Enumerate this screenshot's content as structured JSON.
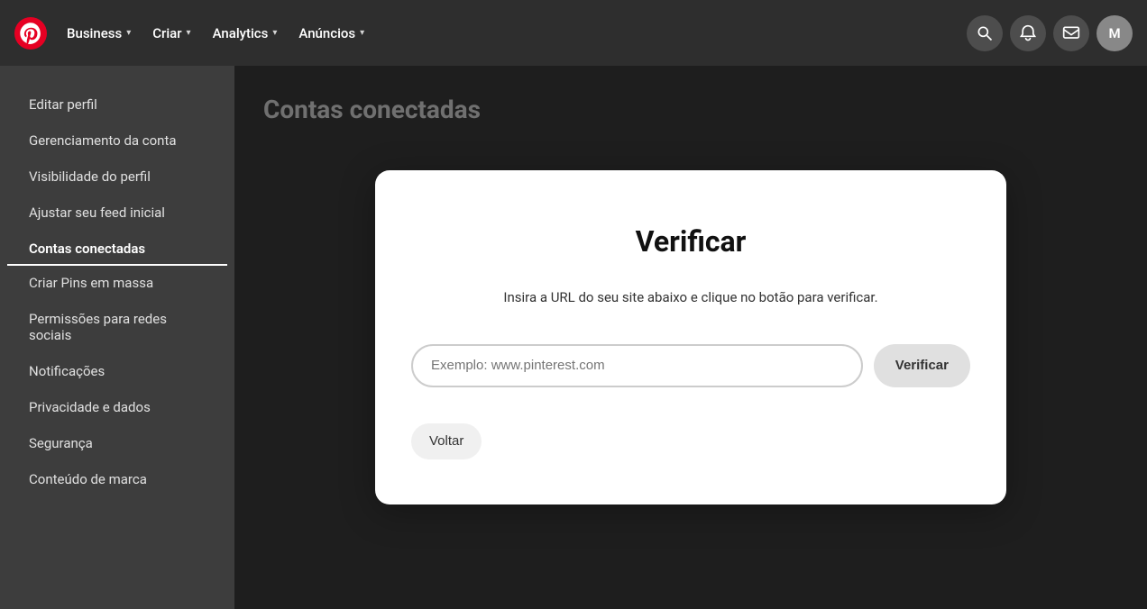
{
  "nav": {
    "logo_label": "Pinterest",
    "items": [
      {
        "label": "Business",
        "has_chevron": true
      },
      {
        "label": "Criar",
        "has_chevron": true
      },
      {
        "label": "Analytics",
        "has_chevron": true
      },
      {
        "label": "Anúncios",
        "has_chevron": true
      }
    ],
    "avatar_initials": "M"
  },
  "sidebar": {
    "items": [
      {
        "label": "Editar perfil",
        "active": false
      },
      {
        "label": "Gerenciamento da conta",
        "active": false
      },
      {
        "label": "Visibilidade do perfil",
        "active": false
      },
      {
        "label": "Ajustar seu feed inicial",
        "active": false
      },
      {
        "label": "Contas conectadas",
        "active": true
      },
      {
        "label": "Criar Pins em massa",
        "active": false
      },
      {
        "label": "Permissões para redes sociais",
        "active": false
      },
      {
        "label": "Notificações",
        "active": false
      },
      {
        "label": "Privacidade e dados",
        "active": false
      },
      {
        "label": "Segurança",
        "active": false
      },
      {
        "label": "Conteúdo de marca",
        "active": false
      }
    ]
  },
  "page": {
    "title": "Contas conectadas"
  },
  "modal": {
    "title": "Verificar",
    "description": "Insira a URL do seu site abaixo e clique no botão para verificar.",
    "input_placeholder": "Exemplo: www.pinterest.com",
    "verify_button": "Verificar",
    "back_button": "Voltar"
  }
}
